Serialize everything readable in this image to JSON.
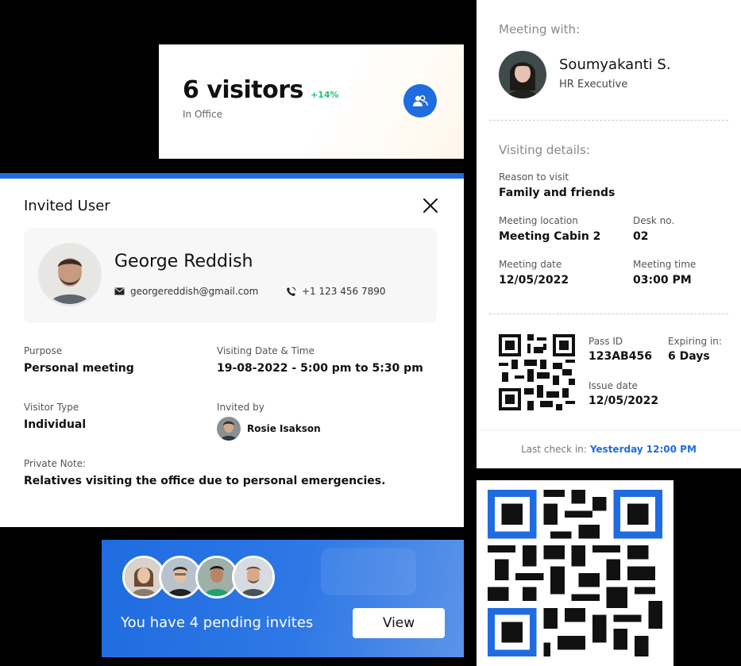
{
  "visitors": {
    "count_label": "6 visitors",
    "change": "+14%",
    "sub_label": "In Office",
    "icon": "users-icon"
  },
  "invited_user": {
    "title": "Invited User",
    "name": "George Reddish",
    "email": "georgereddish@gmail.com",
    "phone": "+1 123 456 7890",
    "purpose_label": "Purpose",
    "purpose_value": "Personal meeting",
    "datetime_label": "Visiting Date & Time",
    "datetime_value": "19-08-2022 - 5:00 pm to 5:30 pm",
    "visitor_type_label": "Visitor Type",
    "visitor_type_value": "Individual",
    "invited_by_label": "Invited by",
    "invited_by_value": "Rosie Isakson",
    "note_label": "Private Note:",
    "note_value": "Relatives visiting the office due to personal emergencies."
  },
  "meeting": {
    "meeting_with_label": "Meeting with:",
    "host_name": "Soumyakanti S.",
    "host_role": "HR Executive",
    "visiting_details_label": "Visiting details:",
    "reason_label": "Reason to visit",
    "reason_value": "Family and friends",
    "location_label": "Meeting location",
    "location_value": "Meeting Cabin 2",
    "desk_label": "Desk no.",
    "desk_value": "02",
    "date_label": "Meeting date",
    "date_value": "12/05/2022",
    "time_label": "Meeting time",
    "time_value": "03:00 PM",
    "pass_id_label": "Pass ID",
    "pass_id_value": "123AB456",
    "expiring_label": "Expiring in:",
    "expiring_value": "6 Days",
    "issue_label": "Issue date",
    "issue_value": "12/05/2022",
    "last_checkin_label": "Last check in:",
    "last_checkin_value": "Yesterday 12:00 PM"
  },
  "pending": {
    "text": "You have 4 pending invites",
    "view_label": "View"
  },
  "colors": {
    "accent": "#1f6ce0",
    "positive": "#21c17b",
    "qr_blue": "#1f6ce0"
  }
}
